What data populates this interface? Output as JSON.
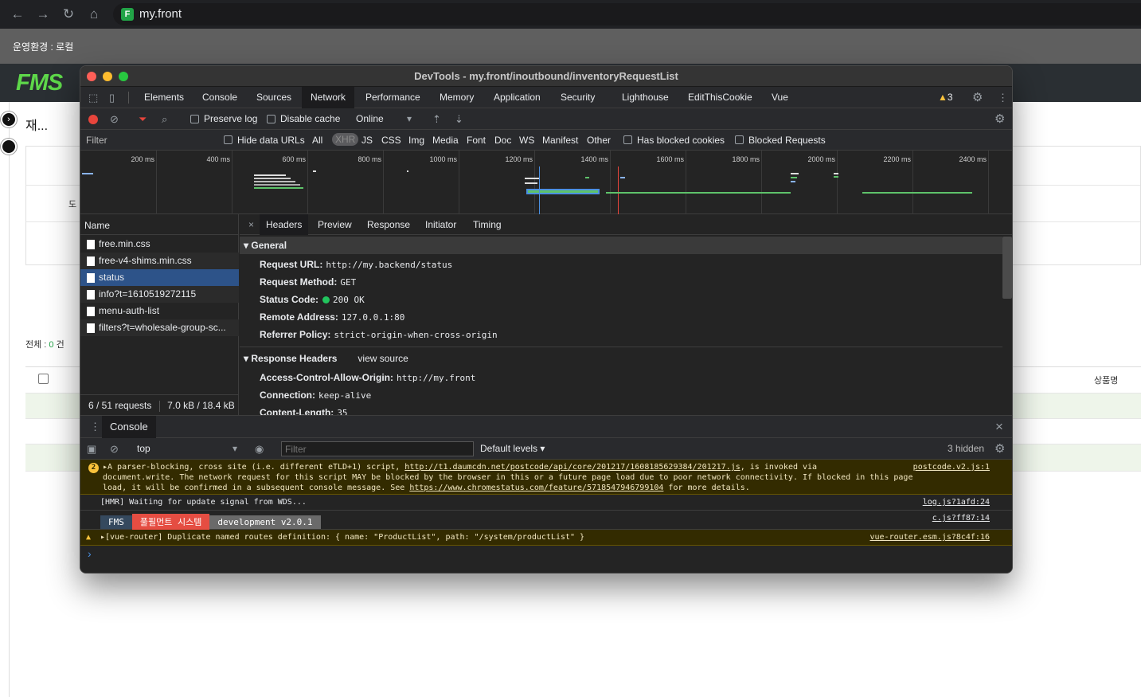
{
  "browser": {
    "url": "my.front",
    "favicon": "F"
  },
  "page": {
    "env_label": "운영환경 : 로컬",
    "logo": "FMS",
    "title": "재...",
    "do_label": "도",
    "total_prefix": "전체 : ",
    "total_count": "0",
    "total_suffix": " 건",
    "goods_col": "상품명"
  },
  "devtools": {
    "title": "DevTools - my.front/inoutbound/inventoryRequestList",
    "tabs": [
      "Elements",
      "Console",
      "Sources",
      "Network",
      "Performance",
      "Memory",
      "Application",
      "Security",
      "Lighthouse",
      "EditThisCookie",
      "Vue"
    ],
    "active_tab": "Network",
    "warning_count": "3",
    "network_toolbar": {
      "preserve_log": "Preserve log",
      "disable_cache": "Disable cache",
      "throttle": "Online"
    },
    "filter_bar": {
      "filter_label": "Filter",
      "hide_data_urls": "Hide data URLs",
      "types": [
        "All",
        "XHR",
        "JS",
        "CSS",
        "Img",
        "Media",
        "Font",
        "Doc",
        "WS",
        "Manifest",
        "Other"
      ],
      "has_blocked_cookies": "Has blocked cookies",
      "blocked_requests": "Blocked Requests"
    },
    "timeline_ticks": [
      "200 ms",
      "400 ms",
      "600 ms",
      "800 ms",
      "1000 ms",
      "1200 ms",
      "1400 ms",
      "1600 ms",
      "1800 ms",
      "2000 ms",
      "2200 ms",
      "2400 ms"
    ],
    "request_list": {
      "header": "Name",
      "items": [
        "free.min.css",
        "free-v4-shims.min.css",
        "status",
        "info?t=1610519272115",
        "menu-auth-list",
        "filters?t=wholesale-group-sc..."
      ],
      "selected": "status",
      "footer_requests": "6 / 51 requests",
      "footer_size": "7.0 kB / 18.4 kB"
    },
    "detail_tabs": [
      "Headers",
      "Preview",
      "Response",
      "Initiator",
      "Timing"
    ],
    "general": {
      "title": "General",
      "rows": [
        {
          "key": "Request URL:",
          "value": "http://my.backend/status"
        },
        {
          "key": "Request Method:",
          "value": "GET"
        },
        {
          "key": "Status Code:",
          "value": "200 OK"
        },
        {
          "key": "Remote Address:",
          "value": "127.0.0.1:80"
        },
        {
          "key": "Referrer Policy:",
          "value": "strict-origin-when-cross-origin"
        }
      ]
    },
    "response_headers": {
      "title": "Response Headers",
      "view_source": "view source",
      "rows": [
        {
          "key": "Access-Control-Allow-Origin:",
          "value": "http://my.front"
        },
        {
          "key": "Connection:",
          "value": "keep-alive"
        },
        {
          "key": "Content-Length:",
          "value": "35"
        }
      ]
    },
    "console": {
      "tab": "Console",
      "context": "top",
      "filter_placeholder": "Filter",
      "levels": "Default levels ▾",
      "hidden": "3 hidden",
      "messages": {
        "parser": {
          "count": "2",
          "line1_prefix": "▸A parser-blocking, cross site (i.e. different eTLD+1) script, ",
          "line1_link": "http://t1.daumcdn.net/postcode/api/core/201217/1608185629384/201217.js",
          "line1_suffix": ", is invoked via",
          "line2": "document.write. The network request for this script MAY be blocked by the browser in this or a future page load due to poor network connectivity. If blocked in this page",
          "line3_prefix": "load, it will be confirmed in a subsequent console message. See ",
          "line3_link": "https://www.chromestatus.com/feature/5718547946799104",
          "line3_suffix": " for more details.",
          "source": "postcode.v2.js:1"
        },
        "hmr": {
          "text": "[HMR] Waiting for update signal from WDS...",
          "source": "log.js?1afd:24"
        },
        "banner": {
          "b1": "FMS",
          "b2": "풀필먼트 시스템",
          "b3": "development v2.0.1",
          "source": "c.js?ff87:14"
        },
        "router": {
          "text": "▸[vue-router] Duplicate named routes definition: { name: \"ProductList\", path: \"/system/productList\" }",
          "source": "vue-router.esm.js?8c4f:16"
        },
        "prompt": "›"
      }
    }
  },
  "colors": {
    "accent_green": "#5ed84a",
    "selected_row": "#2d5389",
    "warning_bg": "#332b00",
    "status_ok": "#22c55e",
    "banner_blue": "#35495e",
    "banner_red": "#e54d42",
    "banner_gray": "#6a6a6a"
  }
}
